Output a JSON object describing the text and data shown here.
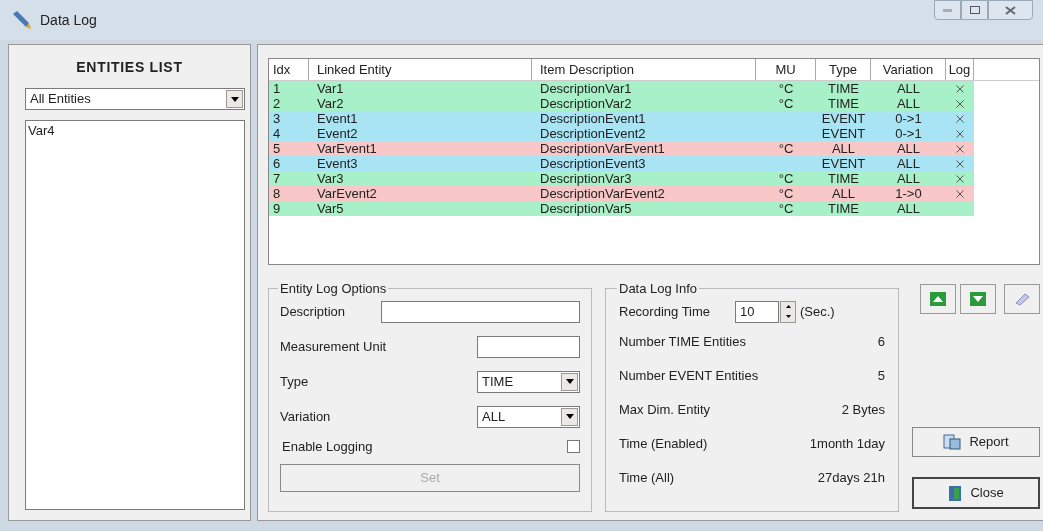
{
  "window": {
    "title": "Data Log"
  },
  "entities_list": {
    "title": "ENTITIES LIST",
    "filter": "All Entities",
    "items": [
      "Var4"
    ]
  },
  "table": {
    "columns": [
      "Idx",
      "Linked Entity",
      "Item Description",
      "MU",
      "Type",
      "Variation",
      "Log"
    ],
    "rows": [
      {
        "idx": "1",
        "entity": "Var1",
        "description": "DescriptionVar1",
        "mu": "°C",
        "type": "TIME",
        "variation": "ALL",
        "logged": true,
        "color": "#a8f0c8"
      },
      {
        "idx": "2",
        "entity": "Var2",
        "description": "DescriptionVar2",
        "mu": "°C",
        "type": "TIME",
        "variation": "ALL",
        "logged": true,
        "color": "#a8f0c8"
      },
      {
        "idx": "3",
        "entity": "Event1",
        "description": "DescriptionEvent1",
        "mu": "",
        "type": "EVENT",
        "variation": "0->1",
        "logged": true,
        "color": "#a8e4f4"
      },
      {
        "idx": "4",
        "entity": "Event2",
        "description": "DescriptionEvent2",
        "mu": "",
        "type": "EVENT",
        "variation": "0->1",
        "logged": true,
        "color": "#a8e4f4"
      },
      {
        "idx": "5",
        "entity": "VarEvent1",
        "description": "DescriptionVarEvent1",
        "mu": "°C",
        "type": "ALL",
        "variation": "ALL",
        "logged": true,
        "color": "#f8c8c8"
      },
      {
        "idx": "6",
        "entity": "Event3",
        "description": "DescriptionEvent3",
        "mu": "",
        "type": "EVENT",
        "variation": "ALL",
        "logged": true,
        "color": "#a8e4f4"
      },
      {
        "idx": "7",
        "entity": "Var3",
        "description": "DescriptionVar3",
        "mu": "°C",
        "type": "TIME",
        "variation": "ALL",
        "logged": true,
        "color": "#a8f0c8"
      },
      {
        "idx": "8",
        "entity": "VarEvent2",
        "description": "DescriptionVarEvent2",
        "mu": "°C",
        "type": "ALL",
        "variation": "1->0",
        "logged": true,
        "color": "#f8c8c8"
      },
      {
        "idx": "9",
        "entity": "Var5",
        "description": "DescriptionVar5",
        "mu": "°C",
        "type": "TIME",
        "variation": "ALL",
        "logged": false,
        "color": "#a8f0c8"
      }
    ]
  },
  "entity_log_options": {
    "title": "Entity Log Options",
    "description_label": "Description",
    "unit_label": "Measurement Unit",
    "type_label": "Type",
    "type_value": "TIME",
    "variation_label": "Variation",
    "variation_value": "ALL",
    "enable_label": "Enable Logging",
    "enable_checked": false,
    "set_button": "Set",
    "set_disabled": true
  },
  "data_log_info": {
    "title": "Data Log Info",
    "recording_label": "Recording Time",
    "recording_value": "10",
    "recording_unit": "(Sec.)",
    "stats": [
      {
        "label": "Number TIME Entities",
        "value": "6"
      },
      {
        "label": "Number EVENT Entities",
        "value": "5"
      },
      {
        "label": "Max Dim. Entity",
        "value": "2 Bytes"
      },
      {
        "label": "Time (Enabled)",
        "value": "1month 1day"
      },
      {
        "label": "Time (All)",
        "value": "27days 21h"
      }
    ]
  },
  "buttons": {
    "report": "Report",
    "close": "Close"
  }
}
